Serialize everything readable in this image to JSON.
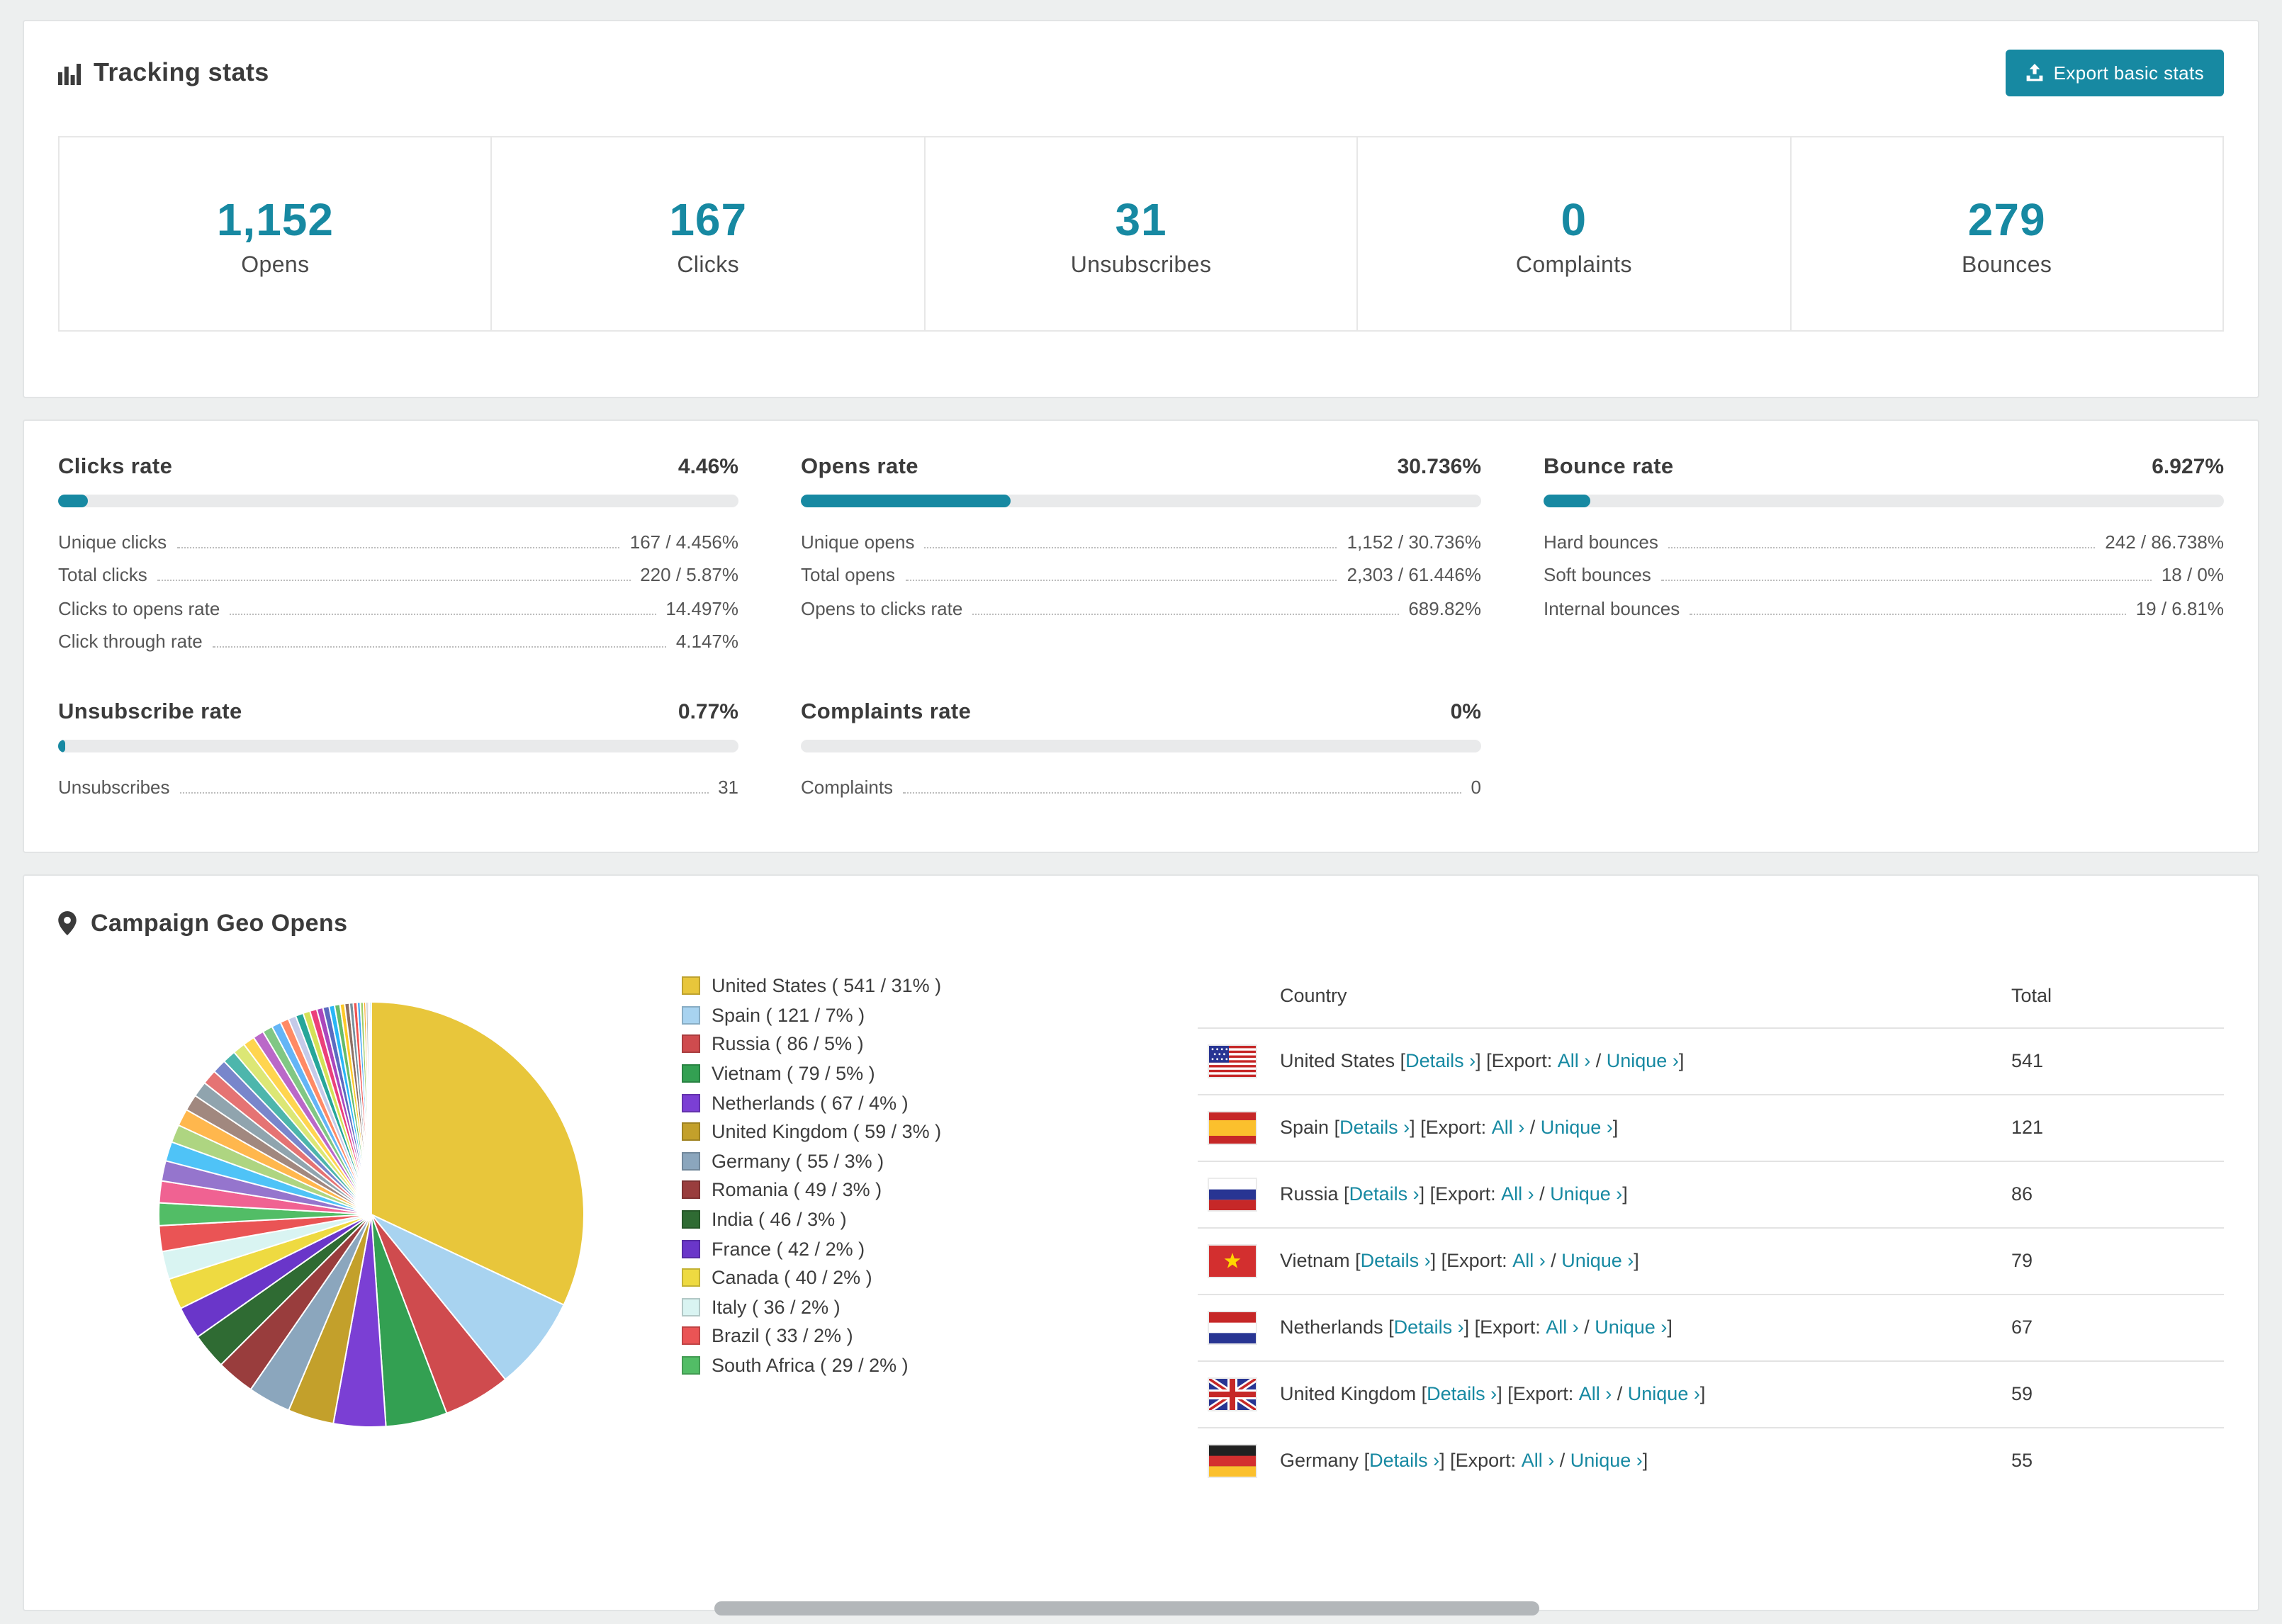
{
  "accent": "#1789a2",
  "tracking": {
    "title": "Tracking stats",
    "export_label": "Export basic stats",
    "stats": [
      {
        "value": "1,152",
        "label": "Opens"
      },
      {
        "value": "167",
        "label": "Clicks"
      },
      {
        "value": "31",
        "label": "Unsubscribes"
      },
      {
        "value": "0",
        "label": "Complaints"
      },
      {
        "value": "279",
        "label": "Bounces"
      }
    ]
  },
  "rates": {
    "panels": [
      {
        "title": "Clicks rate",
        "value": "4.46%",
        "percent": 4.46,
        "rows": [
          {
            "label": "Unique clicks",
            "value": "167 / 4.456%"
          },
          {
            "label": "Total clicks",
            "value": "220 / 5.87%"
          },
          {
            "label": "Clicks to opens rate",
            "value": "14.497%"
          },
          {
            "label": "Click through rate",
            "value": "4.147%"
          }
        ]
      },
      {
        "title": "Opens rate",
        "value": "30.736%",
        "percent": 30.736,
        "rows": [
          {
            "label": "Unique opens",
            "value": "1,152 / 30.736%"
          },
          {
            "label": "Total opens",
            "value": "2,303 / 61.446%"
          },
          {
            "label": "Opens to clicks rate",
            "value": "689.82%"
          }
        ]
      },
      {
        "title": "Bounce rate",
        "value": "6.927%",
        "percent": 6.927,
        "rows": [
          {
            "label": "Hard bounces",
            "value": "242 / 86.738%"
          },
          {
            "label": "Soft bounces",
            "value": "18 / 0%"
          },
          {
            "label": "Internal bounces",
            "value": "19 / 6.81%"
          }
        ]
      },
      {
        "title": "Unsubscribe rate",
        "value": "0.77%",
        "percent": 0.77,
        "rows": [
          {
            "label": "Unsubscribes",
            "value": "31"
          }
        ]
      },
      {
        "title": "Complaints rate",
        "value": "0%",
        "percent": 0,
        "rows": [
          {
            "label": "Complaints",
            "value": "0"
          }
        ]
      }
    ]
  },
  "geo": {
    "title": "Campaign Geo Opens",
    "chart_data": {
      "type": "pie",
      "title": "Campaign Geo Opens",
      "labels": [
        "United States",
        "Spain",
        "Russia",
        "Vietnam",
        "Netherlands",
        "United Kingdom",
        "Germany",
        "Romania",
        "India",
        "France",
        "Canada",
        "Italy",
        "Brazil",
        "South Africa"
      ],
      "values": [
        541,
        121,
        86,
        79,
        67,
        59,
        55,
        49,
        46,
        42,
        40,
        36,
        33,
        29
      ],
      "percents": [
        31,
        7,
        5,
        5,
        4,
        3,
        3,
        3,
        3,
        2,
        2,
        2,
        2,
        2
      ],
      "colors": [
        "#e8c63b",
        "#a8d3f0",
        "#cf4b4e",
        "#33a052",
        "#7b3fd4",
        "#c3a02b",
        "#8ba6bd",
        "#993d3d",
        "#2f6b33",
        "#6a36c9",
        "#eeda41",
        "#d9f4f2",
        "#ea5455",
        "#52bd66"
      ],
      "legend_position": "right",
      "others": {
        "values": [
          28,
          26,
          25,
          23,
          22,
          21,
          20,
          19,
          18,
          17,
          16,
          15,
          14,
          13,
          12,
          11,
          10,
          10,
          9,
          9,
          8,
          8,
          7,
          7,
          6,
          6,
          5,
          5,
          4,
          4,
          3,
          3,
          2,
          2
        ],
        "colors": [
          "#f06292",
          "#9575cd",
          "#4fc3f7",
          "#aed581",
          "#ffb74d",
          "#a1887f",
          "#90a4ae",
          "#e57373",
          "#7986cb",
          "#4db6ac",
          "#dce775",
          "#ffd54f",
          "#ba68c8",
          "#81c784",
          "#64b5f6",
          "#ff8a65",
          "#c5cae9",
          "#26a69a",
          "#d4e157",
          "#ec407a",
          "#ab47bc",
          "#5c6bc0",
          "#29b6f6",
          "#66bb6a",
          "#ffca28",
          "#8d6e63",
          "#78909c",
          "#ef5350",
          "#42a5f5",
          "#9ccc65",
          "#ffa726",
          "#bdbdbd",
          "#7e57c2",
          "#26c6da"
        ]
      }
    },
    "table": {
      "headers": [
        "Country",
        "Total"
      ],
      "links": {
        "open": "[",
        "close": "]",
        "details": "Details ›",
        "export_prefix": "Export:",
        "all": "All ›",
        "separator": "/",
        "unique": "Unique ›"
      },
      "rows": [
        {
          "country": "United States",
          "flag": "us",
          "total": "541"
        },
        {
          "country": "Spain",
          "flag": "es",
          "total": "121"
        },
        {
          "country": "Russia",
          "flag": "ru",
          "total": "86"
        },
        {
          "country": "Vietnam",
          "flag": "vn",
          "total": "79"
        },
        {
          "country": "Netherlands",
          "flag": "nl",
          "total": "67"
        },
        {
          "country": "United Kingdom",
          "flag": "gb",
          "total": "59"
        },
        {
          "country": "Germany",
          "flag": "de",
          "total": "55"
        }
      ]
    }
  }
}
